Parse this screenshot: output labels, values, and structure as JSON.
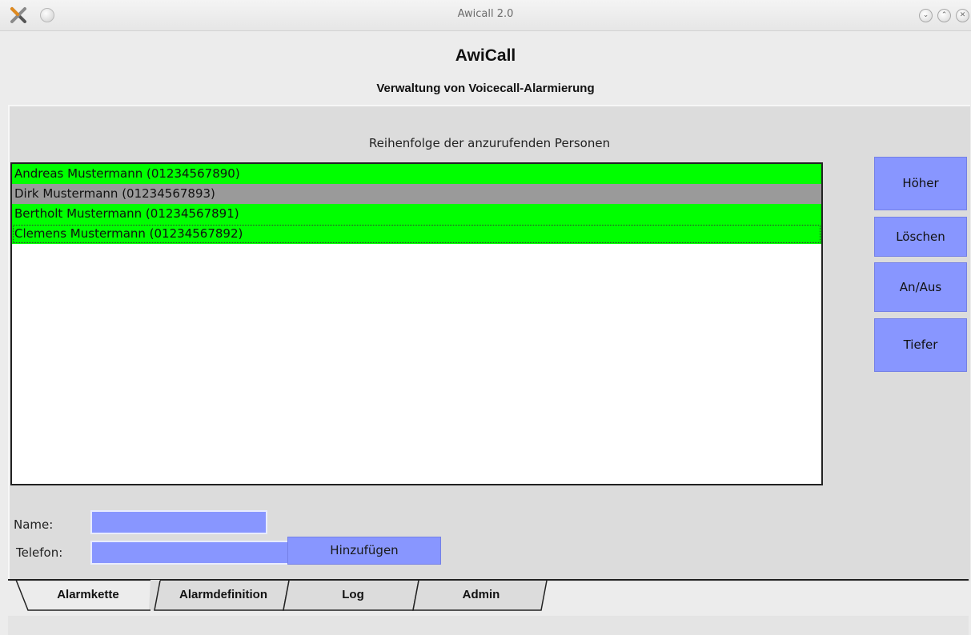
{
  "window": {
    "title": "Awicall 2.0"
  },
  "header": {
    "title": "AwiCall",
    "subtitle": "Verwaltung von Voicecall-Alarmierung"
  },
  "list": {
    "caption": "Reihenfolge der anzurufenden Personen",
    "items": [
      {
        "label": "Andreas Mustermann (01234567890)",
        "active": true
      },
      {
        "label": "Dirk Mustermann (01234567893)",
        "active": false
      },
      {
        "label": "Bertholt Mustermann (01234567891)",
        "active": true
      },
      {
        "label": "Clemens Mustermann (01234567892)",
        "active": true
      }
    ]
  },
  "side_buttons": {
    "up": "Höher",
    "delete": "Löschen",
    "toggle": "An/Aus",
    "down": "Tiefer"
  },
  "form": {
    "name_label": "Name:",
    "name_value": "",
    "phone_label": "Telefon:",
    "phone_value": "",
    "add_label": "Hinzufügen"
  },
  "tabs": [
    {
      "label": "Alarmkette",
      "selected": true
    },
    {
      "label": "Alarmdefinition",
      "selected": false
    },
    {
      "label": "Log",
      "selected": false
    },
    {
      "label": "Admin",
      "selected": false
    }
  ],
  "colors": {
    "active_row": "#00ff00",
    "inactive_row": "#9a9a9a",
    "button": "#8896ff"
  }
}
